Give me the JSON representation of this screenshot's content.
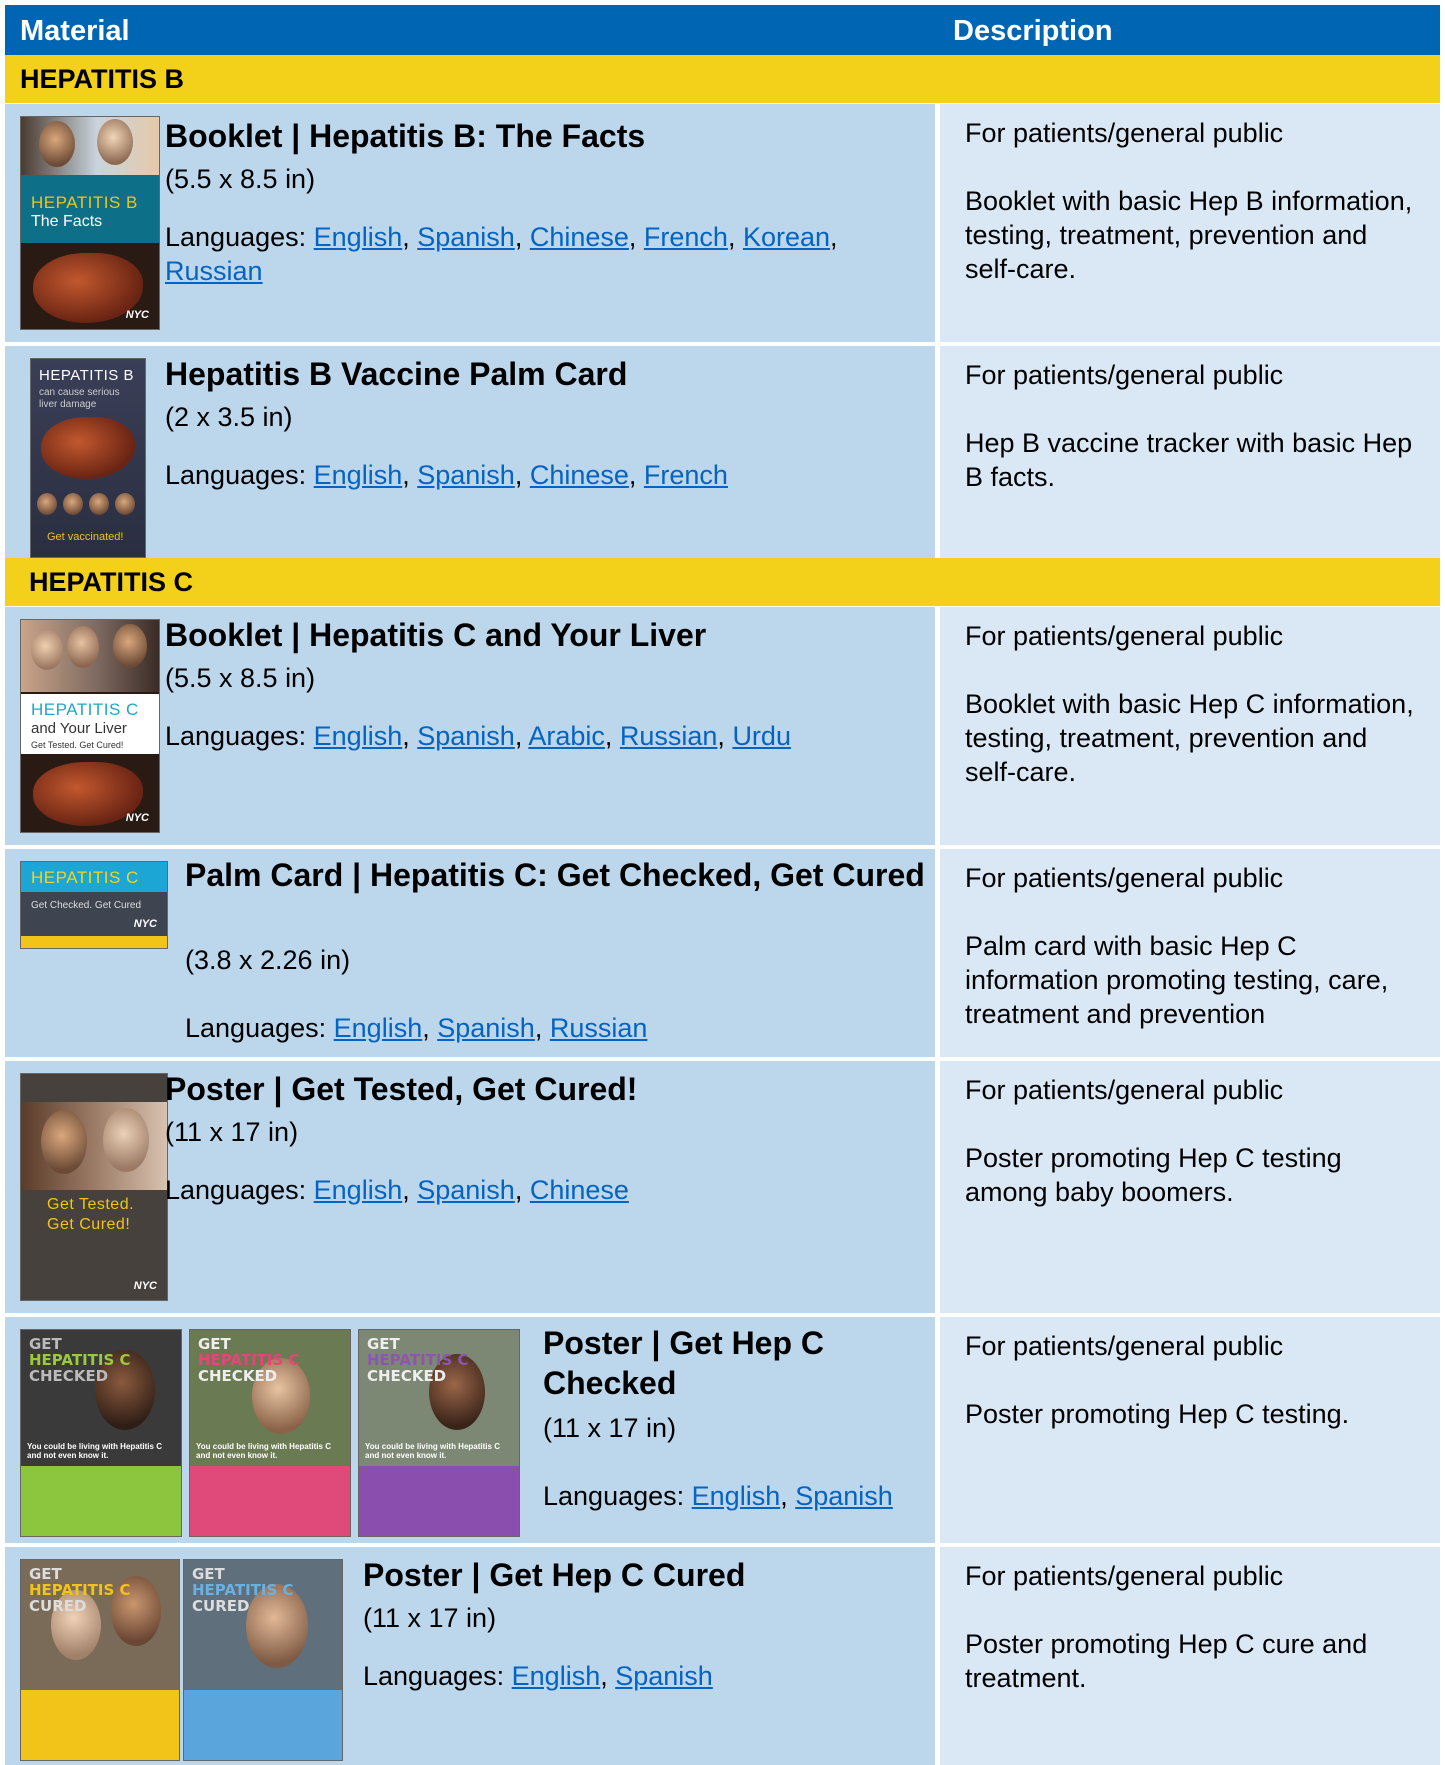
{
  "header": {
    "material": "Material",
    "description": "Description"
  },
  "sections": {
    "hep_b": "HEPATITIS B",
    "hep_c": "HEPATITIS C"
  },
  "languages_label": "Languages:",
  "rows": [
    {
      "title": "Booklet | Hepatitis B: The Facts",
      "size": "(5.5 x 8.5 in)",
      "languages": [
        "English",
        "Spanish",
        "Chinese",
        "French",
        "Korean",
        "Russian"
      ],
      "audience": "For patients/general public",
      "description": "Booklet with basic Hep B information, testing, treatment, prevention and self-care.",
      "thumb": {
        "title": "HEPATITIS B",
        "subtitle": "The Facts",
        "logo": "NYC"
      }
    },
    {
      "title": "Hepatitis B Vaccine Palm Card",
      "size": "(2 x 3.5 in)",
      "languages": [
        "English",
        "Spanish",
        "Chinese",
        "French"
      ],
      "audience": "For patients/general public",
      "description": "Hep B vaccine tracker with basic Hep B facts.",
      "thumb": {
        "title": "HEPATITIS B",
        "subtitle": "can cause serious liver damage",
        "footer": "Get vaccinated!"
      }
    },
    {
      "title": "Booklet | Hepatitis C and Your Liver",
      "size": "(5.5 x 8.5 in)",
      "languages": [
        "English",
        "Spanish",
        "Arabic",
        "Russian",
        "Urdu"
      ],
      "audience": "For patients/general public",
      "description": "Booklet with basic Hep C information, testing, treatment, prevention and self-care.",
      "thumb": {
        "title": "HEPATITIS C",
        "subtitle": "and Your Liver",
        "tagline": "Get Tested. Get Cured!",
        "logo": "NYC"
      }
    },
    {
      "title": "Palm Card | Hepatitis C: Get Checked, Get Cured",
      "size": "(3.8 x 2.26 in)",
      "languages": [
        "English",
        "Spanish",
        "Russian"
      ],
      "audience": "For patients/general public",
      "description": "Palm card with basic Hep C information promoting testing, care, treatment and prevention",
      "thumb": {
        "title": "HEPATITIS C",
        "subtitle": "Get Checked. Get Cured",
        "logo": "NYC"
      }
    },
    {
      "title": "Poster | Get Tested, Get Cured!",
      "size": "(11 x 17 in)",
      "languages": [
        "English",
        "Spanish",
        "Chinese"
      ],
      "audience": "For patients/general public",
      "description": "Poster promoting Hep C testing among baby boomers.",
      "thumb": {
        "line1": "Get Tested.",
        "line2": "Get Cured!",
        "logo": "NYC"
      }
    },
    {
      "title": "Poster | Get Hep C Checked",
      "size": "(11 x 17 in)",
      "languages": [
        "English",
        "Spanish"
      ],
      "audience": "For patients/general public",
      "description": "Poster promoting Hep C testing.",
      "thumb": {
        "line1": "GET",
        "line2": "HEPATITIS C",
        "line3": "CHECKED",
        "caption": "You could be living with Hepatitis C and not even know it."
      }
    },
    {
      "title": "Poster | Get Hep C Cured",
      "size": "(11 x 17 in)",
      "languages": [
        "English",
        "Spanish"
      ],
      "audience": "For patients/general public",
      "description": "Poster promoting Hep C cure and treatment.",
      "thumb": {
        "line1": "GET",
        "line2": "HEPATITIS C",
        "line3": "CURED"
      }
    }
  ],
  "colors": {
    "header": "#0066b3",
    "section": "#f3d11a",
    "material_cell": "#bcd6ec",
    "description_cell": "#dae8f5",
    "link": "#0563c1"
  }
}
